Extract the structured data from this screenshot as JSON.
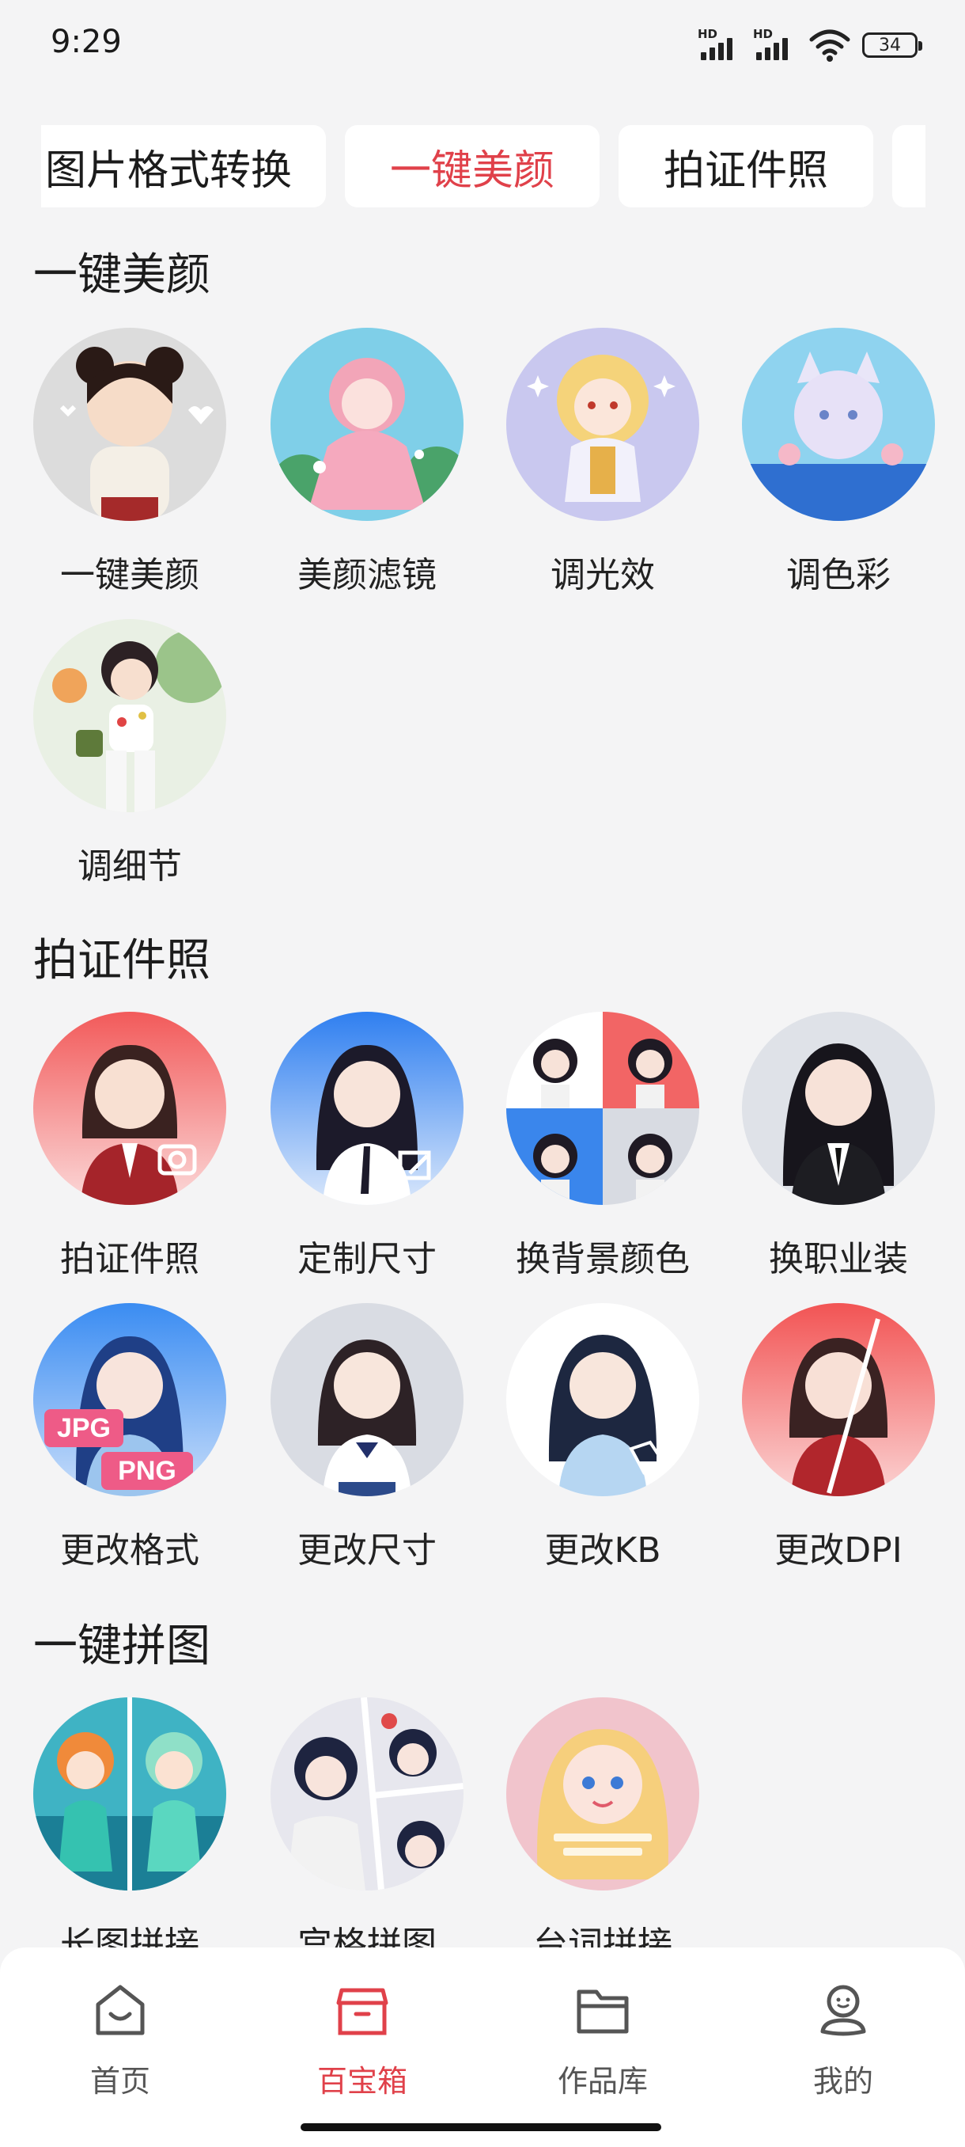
{
  "status_bar": {
    "time": "9:29",
    "battery": "34",
    "sim1": "HD",
    "sim2": "HD"
  },
  "tabs": [
    {
      "label": "图片格式转换",
      "active": false
    },
    {
      "label": "一键美颜",
      "active": true
    },
    {
      "label": "拍证件照",
      "active": false
    }
  ],
  "sections": {
    "beauty": {
      "title": "一键美颜",
      "items": [
        "一键美颜",
        "美颜滤镜",
        "调光效",
        "调色彩",
        "调细节"
      ]
    },
    "id_photo": {
      "title": "拍证件照",
      "items": [
        "拍证件照",
        "定制尺寸",
        "换背景颜色",
        "换职业装",
        "更改格式",
        "更改尺寸",
        "更改KB",
        "更改DPI"
      ],
      "badges": {
        "jpg": "JPG",
        "png": "PNG"
      }
    },
    "collage": {
      "title": "一键拼图",
      "items": [
        "长图拼接",
        "宫格拼图",
        "台词拼接"
      ]
    }
  },
  "bottom_nav": [
    {
      "label": "首页",
      "icon": "home-icon",
      "active": false
    },
    {
      "label": "百宝箱",
      "icon": "toolbox-icon",
      "active": true
    },
    {
      "label": "作品库",
      "icon": "folder-icon",
      "active": false
    },
    {
      "label": "我的",
      "icon": "profile-icon",
      "active": false
    }
  ],
  "colors": {
    "accent": "#e0414a",
    "background": "#f4f4f5",
    "card": "#ffffff"
  }
}
